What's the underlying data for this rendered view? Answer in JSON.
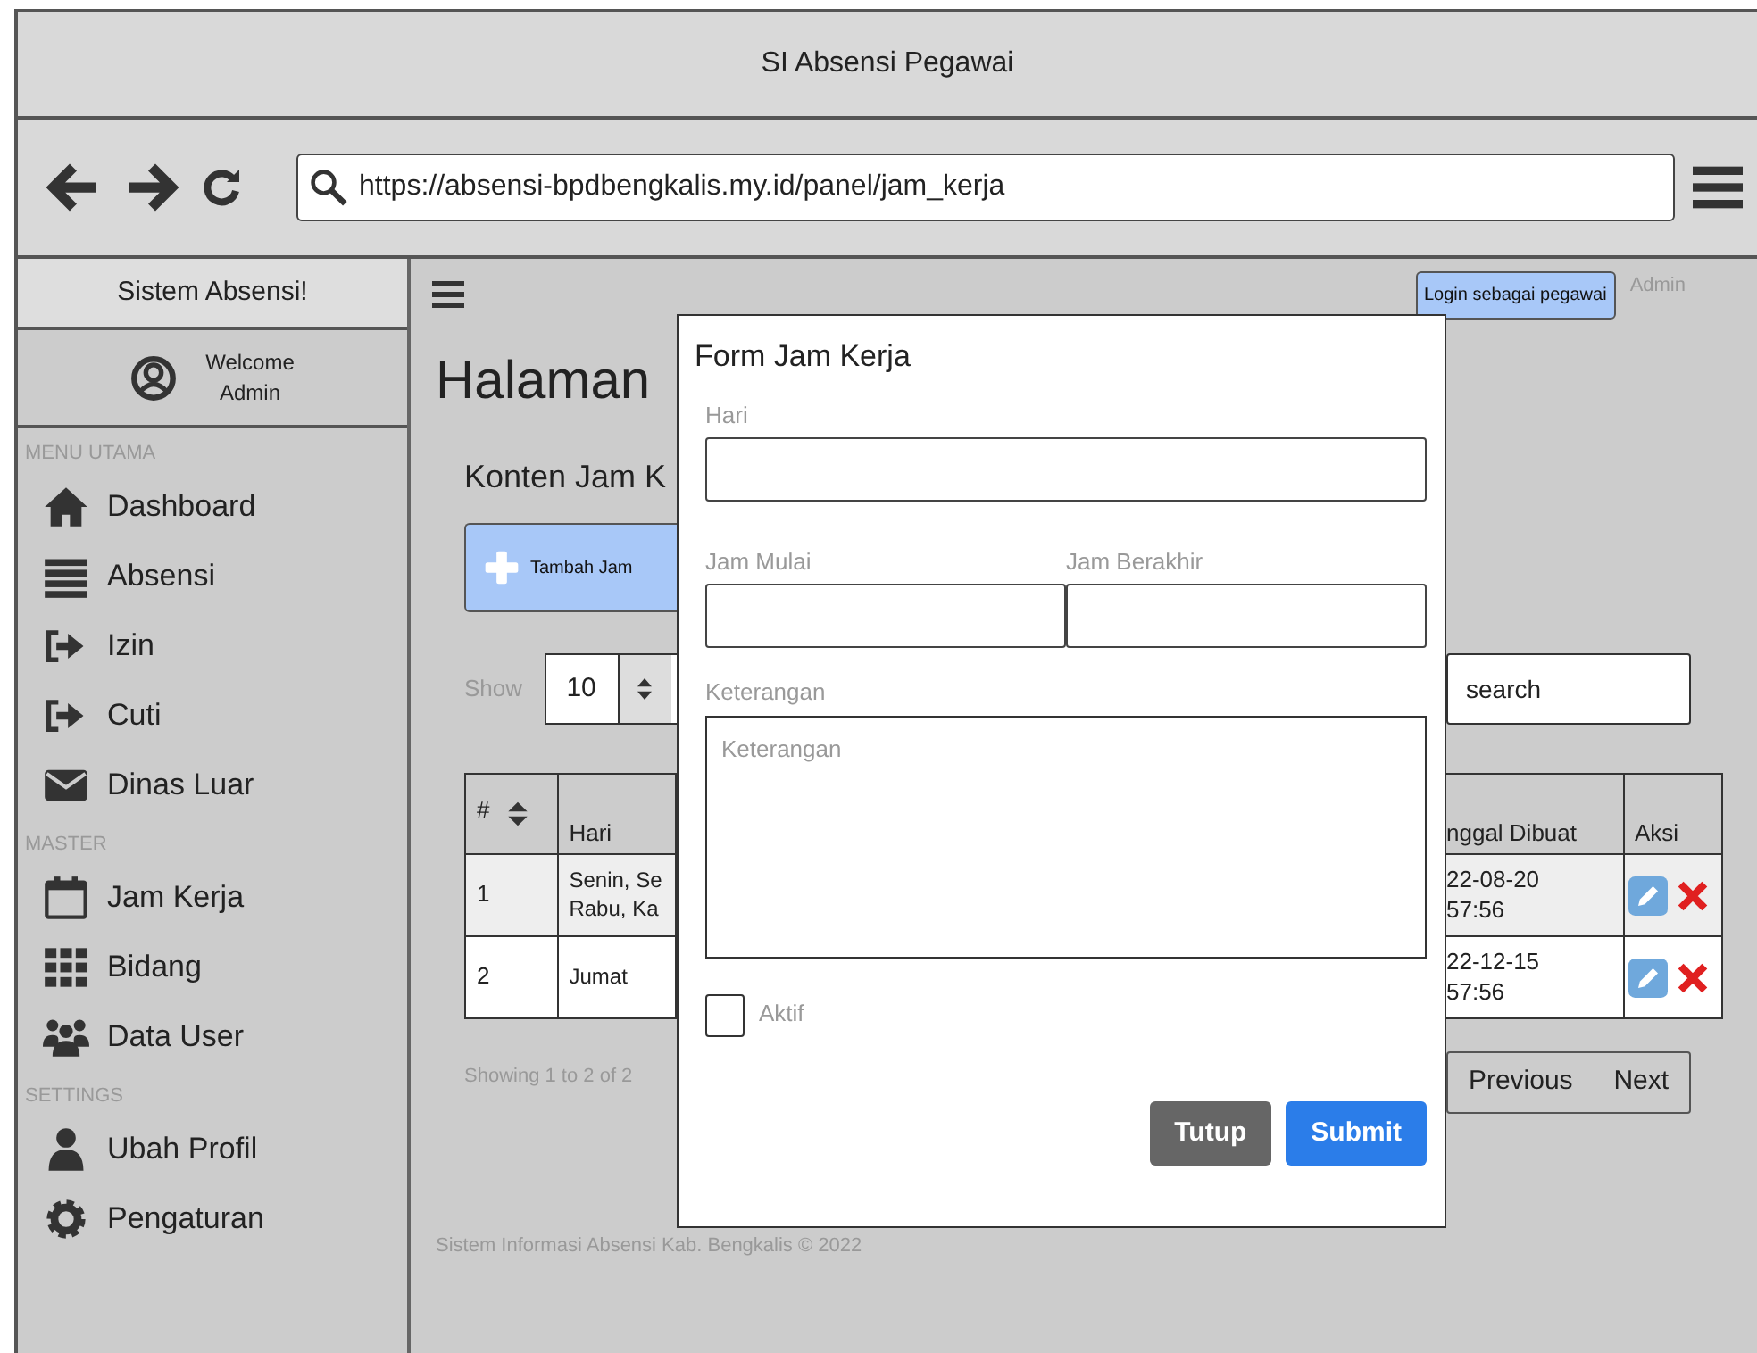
{
  "window": {
    "title": "SI Absensi Pegawai"
  },
  "address_bar": {
    "url": "https://absensi-bpdbengkalis.my.id/panel/jam_kerja"
  },
  "sidebar": {
    "brand": "Sistem Absensi!",
    "welcome": "Welcome",
    "user": "Admin",
    "sections": [
      {
        "heading": "MENU UTAMA",
        "items": [
          {
            "label": "Dashboard",
            "kind": "home"
          },
          {
            "label": "Absensi",
            "kind": "list"
          },
          {
            "label": "Izin",
            "kind": "signin"
          },
          {
            "label": "Cuti",
            "kind": "signin"
          },
          {
            "label": "Dinas Luar",
            "kind": "envelope"
          }
        ]
      },
      {
        "heading": "MASTER",
        "items": [
          {
            "label": "Jam Kerja",
            "kind": "calendar"
          },
          {
            "label": "Bidang",
            "kind": "grid"
          },
          {
            "label": "Data User",
            "kind": "users"
          }
        ]
      },
      {
        "heading": "SETTINGS",
        "items": [
          {
            "label": "Ubah Profil",
            "kind": "user"
          },
          {
            "label": "Pengaturan",
            "kind": "gear"
          }
        ]
      }
    ]
  },
  "topbar": {
    "login_button": "Login sebagai pegawai",
    "user": "Admin"
  },
  "page": {
    "title": "Halaman",
    "subtitle": "Konten Jam K",
    "add_button": "Tambah Jam",
    "show_label": "Show",
    "page_size": "10",
    "search": {
      "placeholder": "search"
    },
    "table": {
      "columns_left": [
        "#",
        "Hari"
      ],
      "columns_right": [
        "nggal Dibuat",
        "Aksi"
      ],
      "rows": [
        {
          "number": "1",
          "hari": "Senin, Se\nRabu, Ka",
          "dibuat": "22-08-20\n57:56"
        },
        {
          "number": "2",
          "hari": "Jumat",
          "dibuat": "22-12-15\n57:56"
        }
      ]
    },
    "info": "Showing 1 to 2 of 2",
    "pagination": [
      "Previous",
      "Next"
    ]
  },
  "footer": "Sistem Informasi Absensi Kab. Bengkalis © 2022",
  "modal": {
    "title": "Form Jam Kerja",
    "rows": [
      [
        {
          "label": "Hari",
          "kind": "text"
        }
      ],
      [
        {
          "label": "Jam Mulai",
          "kind": "text"
        },
        {
          "label": "Jam Berakhir",
          "kind": "text"
        }
      ],
      [
        {
          "label": "Keterangan",
          "kind": "textarea",
          "placeholder": "Keterangan"
        }
      ]
    ],
    "checkbox": {
      "label": "Aktif",
      "checked": false
    },
    "buttons": [
      {
        "label": "Tutup",
        "kind": "secondary"
      },
      {
        "label": "Submit",
        "kind": "primary"
      }
    ]
  }
}
